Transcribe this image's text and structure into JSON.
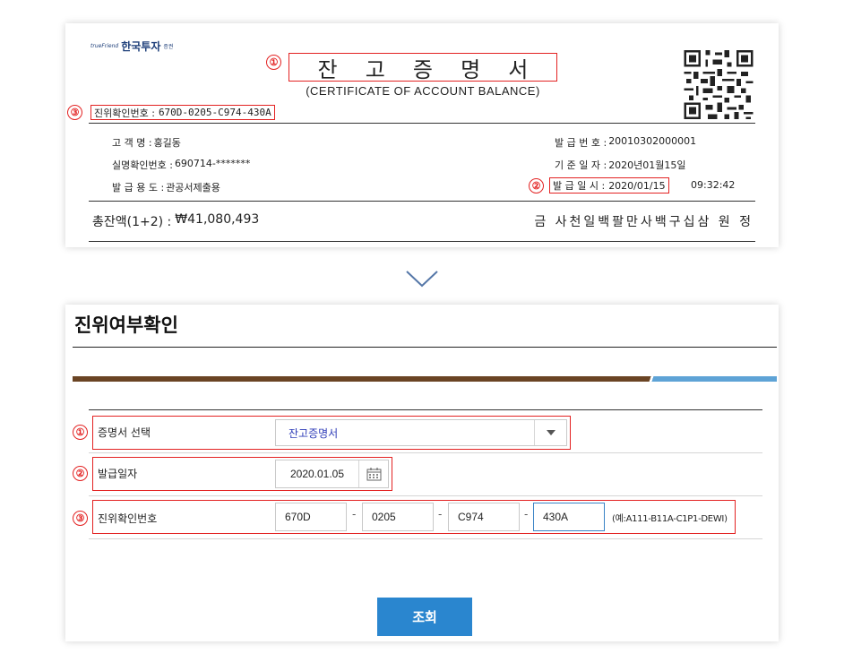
{
  "certificate": {
    "logo_en": "trueFriend",
    "logo_ko": "한국투자",
    "logo_sub": "증권",
    "title_chars": [
      "잔",
      "고",
      "증",
      "명",
      "서"
    ],
    "subtitle": "(CERTIFICATE OF ACCOUNT BALANCE)",
    "verify_label": "진위확인번호 :",
    "verify_value": "670D-0205-C974-430A",
    "left_fields": [
      {
        "label": "고   객   명 :",
        "value": "홍길동"
      },
      {
        "label": "실명확인번호 :",
        "value": "690714-*******"
      },
      {
        "label": "발  급   용 도 :",
        "value": "관공서제출용"
      }
    ],
    "right_fields": [
      {
        "label": "발 급 번 호 :",
        "value": "20010302000001"
      },
      {
        "label": "기 준 일 자 :",
        "value": "2020년01월15일"
      }
    ],
    "issued_label": "발 급 일 시 :",
    "issued_date": "2020/01/15",
    "issued_time": "09:32:42",
    "total_label": "총잔액(1+2) :",
    "total_value": "₩41,080,493",
    "amount_korean": "금 사천일백팔만사백구십삼 원 정",
    "markers": [
      "①",
      "②",
      "③"
    ]
  },
  "form": {
    "title": "진위여부확인",
    "rows": [
      {
        "marker": "①",
        "label": "증명서 선택",
        "value": "잔고증명서"
      },
      {
        "marker": "②",
        "label": "발급일자",
        "value": "2020.01.05"
      },
      {
        "marker": "③",
        "label": "진위확인번호",
        "segments": [
          "670D",
          "0205",
          "C974",
          "430A"
        ],
        "dash": "-",
        "example": "(예:A111-B11A-C1P1-DEWI)"
      }
    ],
    "search_label": "조회"
  },
  "colors": {
    "highlight": "#e32222",
    "brand_brown": "#6a4424",
    "brand_blue": "#5ea3d6",
    "button": "#2a86cf",
    "select_text": "#2f3db8"
  },
  "icons": {
    "dropdown": "chevron-down-icon",
    "calendar": "calendar-icon",
    "arrow": "chevron-down-icon",
    "qr": "qr-code-icon"
  }
}
